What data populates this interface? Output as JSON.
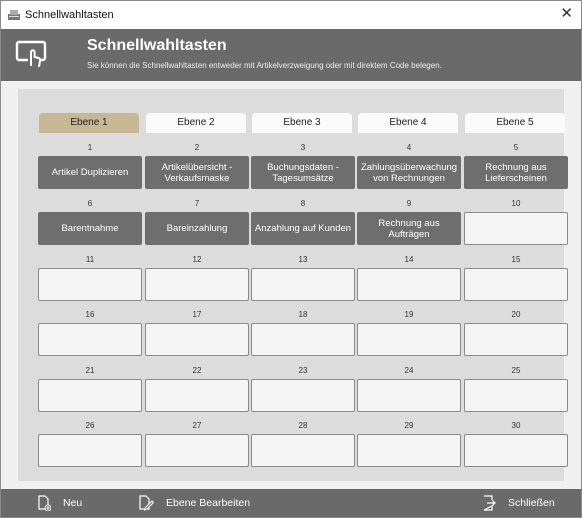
{
  "window": {
    "title": "Schnellwahltasten"
  },
  "header": {
    "title": "Schnellwahltasten",
    "subtitle": "Sie können die Schnellwahltasten entweder mit Artikelverzweigung oder mit direktem Code belegen."
  },
  "tabs": [
    {
      "label": "Ebene 1",
      "active": true
    },
    {
      "label": "Ebene 2",
      "active": false
    },
    {
      "label": "Ebene 3",
      "active": false
    },
    {
      "label": "Ebene 4",
      "active": false
    },
    {
      "label": "Ebene 5",
      "active": false
    }
  ],
  "slots": [
    {
      "num": "1",
      "label": "Artikel Duplizieren"
    },
    {
      "num": "2",
      "label": "Artikelübersicht - Verkaufsmaske"
    },
    {
      "num": "3",
      "label": "Buchungsdaten - Tagesumsätze"
    },
    {
      "num": "4",
      "label": "Zahlungsüberwachung von Rechnungen"
    },
    {
      "num": "5",
      "label": "Rechnung aus Lieferscheinen"
    },
    {
      "num": "6",
      "label": "Barentnahme"
    },
    {
      "num": "7",
      "label": "Bareinzahlung"
    },
    {
      "num": "8",
      "label": "Anzahlung auf Kunden"
    },
    {
      "num": "9",
      "label": "Rechnung aus Aufträgen"
    },
    {
      "num": "10",
      "label": ""
    },
    {
      "num": "11",
      "label": ""
    },
    {
      "num": "12",
      "label": ""
    },
    {
      "num": "13",
      "label": ""
    },
    {
      "num": "14",
      "label": ""
    },
    {
      "num": "15",
      "label": ""
    },
    {
      "num": "16",
      "label": ""
    },
    {
      "num": "17",
      "label": ""
    },
    {
      "num": "18",
      "label": ""
    },
    {
      "num": "19",
      "label": ""
    },
    {
      "num": "20",
      "label": ""
    },
    {
      "num": "21",
      "label": ""
    },
    {
      "num": "22",
      "label": ""
    },
    {
      "num": "23",
      "label": ""
    },
    {
      "num": "24",
      "label": ""
    },
    {
      "num": "25",
      "label": ""
    },
    {
      "num": "26",
      "label": ""
    },
    {
      "num": "27",
      "label": ""
    },
    {
      "num": "28",
      "label": ""
    },
    {
      "num": "29",
      "label": ""
    },
    {
      "num": "30",
      "label": ""
    }
  ],
  "footer": {
    "new_label": "Neu",
    "edit_label": "Ebene Bearbeiten",
    "close_label": "Schließen"
  },
  "colors": {
    "header_bg": "#6a6a6a",
    "active_tab": "#c6b894",
    "filled_slot": "#6e6e6e"
  }
}
